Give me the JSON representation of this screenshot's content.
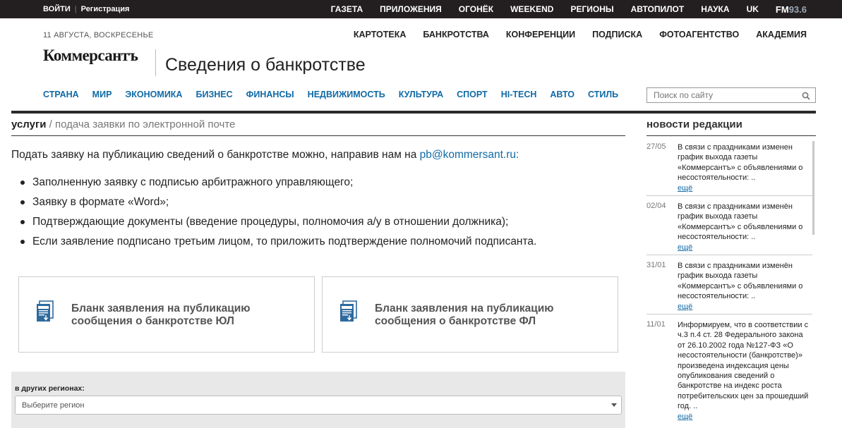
{
  "topbar": {
    "login": "ВОЙТИ",
    "separator": "|",
    "register": "Регистрация",
    "sites": [
      "ГАЗЕТА",
      "ПРИЛОЖЕНИЯ",
      "ОГОНЁК",
      "WEEKEND",
      "РЕГИОНЫ",
      "АВТОПИЛОТ",
      "НАУКА",
      "UK"
    ],
    "fm_label": "FM",
    "fm_freq": "93.6"
  },
  "header": {
    "date": "11 АВГУСТА, ВОСКРЕСЕНЬЕ",
    "secondary_nav": [
      "КАРТОТЕКА",
      "БАНКРОТСТВА",
      "КОНФЕРЕНЦИИ",
      "ПОДПИСКА",
      "ФОТОАГЕНТСТВО",
      "АКАДЕМИЯ"
    ],
    "logo": "Коммерсантъ",
    "section_title": "Сведения о банкротстве"
  },
  "rubrics": [
    "СТРАНА",
    "МИР",
    "ЭКОНОМИКА",
    "БИЗНЕС",
    "ФИНАНСЫ",
    "НЕДВИЖИМОСТЬ",
    "КУЛЬТУРА",
    "СПОРТ",
    "HI-TECH",
    "АВТО",
    "СТИЛЬ"
  ],
  "search": {
    "placeholder": "Поиск по сайту",
    "icon": "search-icon"
  },
  "breadcrumb": {
    "root": "услуги",
    "separator": "/",
    "current": "подача заявки по электронной почте"
  },
  "main": {
    "intro_text": "Подать заявку на публикацию сведений о банкротстве можно, направив нам на ",
    "email": "pb@kommersant.ru",
    "intro_suffix": ":",
    "requirements": [
      "Заполненную заявку с подписью арбитражного управляющего;",
      "Заявку в формате «Word»;",
      "Подтверждающие документы (введение процедуры, полномочия а/у в отношении должника);",
      "Если заявление подписано третьим лицом, то приложить подтверждение полномочий подписанта."
    ],
    "cards": [
      {
        "icon": "document-download-icon",
        "title": "Бланк заявления на публикацию сообщения о банкротстве ЮЛ"
      },
      {
        "icon": "document-download-icon",
        "title": "Бланк заявления на публикацию сообщения о банкротстве ФЛ"
      }
    ],
    "regions": {
      "label": "в других регионах:",
      "placeholder": "Выберите регион"
    }
  },
  "news": {
    "heading": "новости редакции",
    "items": [
      {
        "date": "27/05",
        "text": "В связи с праздниками изменен график выхода газеты «Коммерсантъ» с объявлениями о несостоятельности: ..",
        "more": "ещё"
      },
      {
        "date": "02/04",
        "text": "В связи с праздниками изменён график выхода газеты «Коммерсантъ» с объявлениями о несостоятельности: ..",
        "more": "ещё"
      },
      {
        "date": "31/01",
        "text": "В связи с праздниками изменён график выхода газеты «Коммерсантъ» с объявлениями о несостоятельности: ..",
        "more": "ещё"
      },
      {
        "date": "11/01",
        "text": "Информируем, что в соответствии с ч.3 п.4 ст. 28 Федерального закона от 26.10.2002 года №127-ФЗ «О несостоятельности (банкротстве)» произведена индексация цены опубликования сведений о банкротстве на индекс роста потребительских цен за прошедший год. ..",
        "more": "ещё"
      }
    ]
  },
  "colors": {
    "topbar_bg": "#231f20",
    "link_blue": "#106aa6",
    "card_icon_blue": "#2e6a9e",
    "region_panel_bg": "#e8e8e8"
  }
}
